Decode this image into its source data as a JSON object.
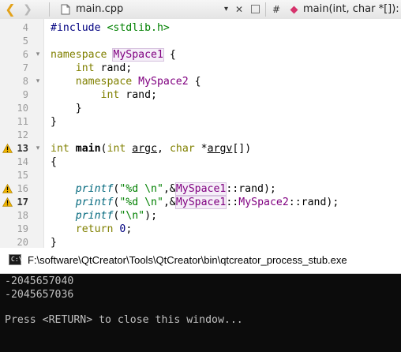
{
  "tabbar": {
    "file_name": "main.cpp",
    "dropdown": "▾",
    "close": "✕",
    "hash": "#",
    "symbol": "main(int, char *[]): int"
  },
  "editor": {
    "lines": [
      {
        "n": "4",
        "warn": false,
        "fold": "",
        "segments": [
          {
            "t": "#include ",
            "c": "inc"
          },
          {
            "t": "<stdlib.h>",
            "c": "str"
          }
        ]
      },
      {
        "n": "5",
        "warn": false,
        "fold": "",
        "segments": []
      },
      {
        "n": "6",
        "warn": false,
        "fold": "▾",
        "segments": [
          {
            "t": "namespace ",
            "c": "kw"
          },
          {
            "t": "MySpace1",
            "c": "ns"
          },
          {
            "t": " {",
            "c": ""
          }
        ]
      },
      {
        "n": "7",
        "warn": false,
        "fold": "",
        "segments": [
          {
            "t": "    ",
            "c": ""
          },
          {
            "t": "int",
            "c": "kw"
          },
          {
            "t": " rand;",
            "c": ""
          }
        ]
      },
      {
        "n": "8",
        "warn": false,
        "fold": "▾",
        "segments": [
          {
            "t": "    ",
            "c": ""
          },
          {
            "t": "namespace ",
            "c": "kw"
          },
          {
            "t": "MySpace2",
            "c": "typ"
          },
          {
            "t": " {",
            "c": ""
          }
        ]
      },
      {
        "n": "9",
        "warn": false,
        "fold": "",
        "segments": [
          {
            "t": "        ",
            "c": ""
          },
          {
            "t": "int",
            "c": "kw"
          },
          {
            "t": " rand;",
            "c": ""
          }
        ]
      },
      {
        "n": "10",
        "warn": false,
        "fold": "",
        "segments": [
          {
            "t": "    }",
            "c": ""
          }
        ]
      },
      {
        "n": "11",
        "warn": false,
        "fold": "",
        "segments": [
          {
            "t": "}",
            "c": ""
          }
        ]
      },
      {
        "n": "12",
        "warn": false,
        "fold": "",
        "segments": []
      },
      {
        "n": "13",
        "warn": true,
        "fold": "▾",
        "segments": [
          {
            "t": "int",
            "c": "kw"
          },
          {
            "t": " ",
            "c": ""
          },
          {
            "t": "main",
            "c": "bold-fn"
          },
          {
            "t": "(",
            "c": ""
          },
          {
            "t": "int",
            "c": "kw"
          },
          {
            "t": " ",
            "c": ""
          },
          {
            "t": "argc",
            "c": "under"
          },
          {
            "t": ", ",
            "c": ""
          },
          {
            "t": "char",
            "c": "kw"
          },
          {
            "t": " *",
            "c": ""
          },
          {
            "t": "argv",
            "c": "under"
          },
          {
            "t": "[])",
            "c": ""
          }
        ]
      },
      {
        "n": "14",
        "warn": false,
        "fold": "",
        "segments": [
          {
            "t": "{",
            "c": ""
          }
        ]
      },
      {
        "n": "15",
        "warn": false,
        "fold": "",
        "segments": []
      },
      {
        "n": "16",
        "warn": true,
        "fold": "",
        "segments": [
          {
            "t": "    ",
            "c": ""
          },
          {
            "t": "printf",
            "c": "fn"
          },
          {
            "t": "(",
            "c": ""
          },
          {
            "t": "\"%d \\n\"",
            "c": "str"
          },
          {
            "t": ",&",
            "c": ""
          },
          {
            "t": "MySpace1",
            "c": "ns"
          },
          {
            "t": "::rand);",
            "c": ""
          }
        ]
      },
      {
        "n": "17",
        "warn": true,
        "fold": "",
        "segments": [
          {
            "t": "    ",
            "c": ""
          },
          {
            "t": "printf",
            "c": "fn"
          },
          {
            "t": "(",
            "c": ""
          },
          {
            "t": "\"%d \\n\"",
            "c": "str"
          },
          {
            "t": ",&",
            "c": ""
          },
          {
            "t": "MySpace1",
            "c": "ns"
          },
          {
            "t": "::",
            "c": ""
          },
          {
            "t": "MySpace2",
            "c": "typ"
          },
          {
            "t": "::rand);",
            "c": ""
          }
        ]
      },
      {
        "n": "18",
        "warn": false,
        "fold": "",
        "segments": [
          {
            "t": "    ",
            "c": ""
          },
          {
            "t": "printf",
            "c": "fn"
          },
          {
            "t": "(",
            "c": ""
          },
          {
            "t": "\"\\n\"",
            "c": "str"
          },
          {
            "t": ");",
            "c": ""
          }
        ]
      },
      {
        "n": "19",
        "warn": false,
        "fold": "",
        "segments": [
          {
            "t": "    ",
            "c": ""
          },
          {
            "t": "return",
            "c": "kw"
          },
          {
            "t": " ",
            "c": ""
          },
          {
            "t": "0",
            "c": "num"
          },
          {
            "t": ";",
            "c": ""
          }
        ]
      },
      {
        "n": "20",
        "warn": false,
        "fold": "",
        "segments": [
          {
            "t": "}",
            "c": ""
          }
        ]
      }
    ]
  },
  "console": {
    "icon_text": "C:\\",
    "title": "F:\\software\\QtCreator\\Tools\\QtCreator\\bin\\qtcreator_process_stub.exe",
    "output": [
      "-2045657040",
      "-2045657036",
      "Press <RETURN> to close this window..."
    ]
  },
  "colors": {
    "keyword": "#808000",
    "type": "#800080",
    "string": "#008000",
    "warning": "#f0b400",
    "console_bg": "#0c0c0c",
    "console_text": "#c0c0c0"
  }
}
